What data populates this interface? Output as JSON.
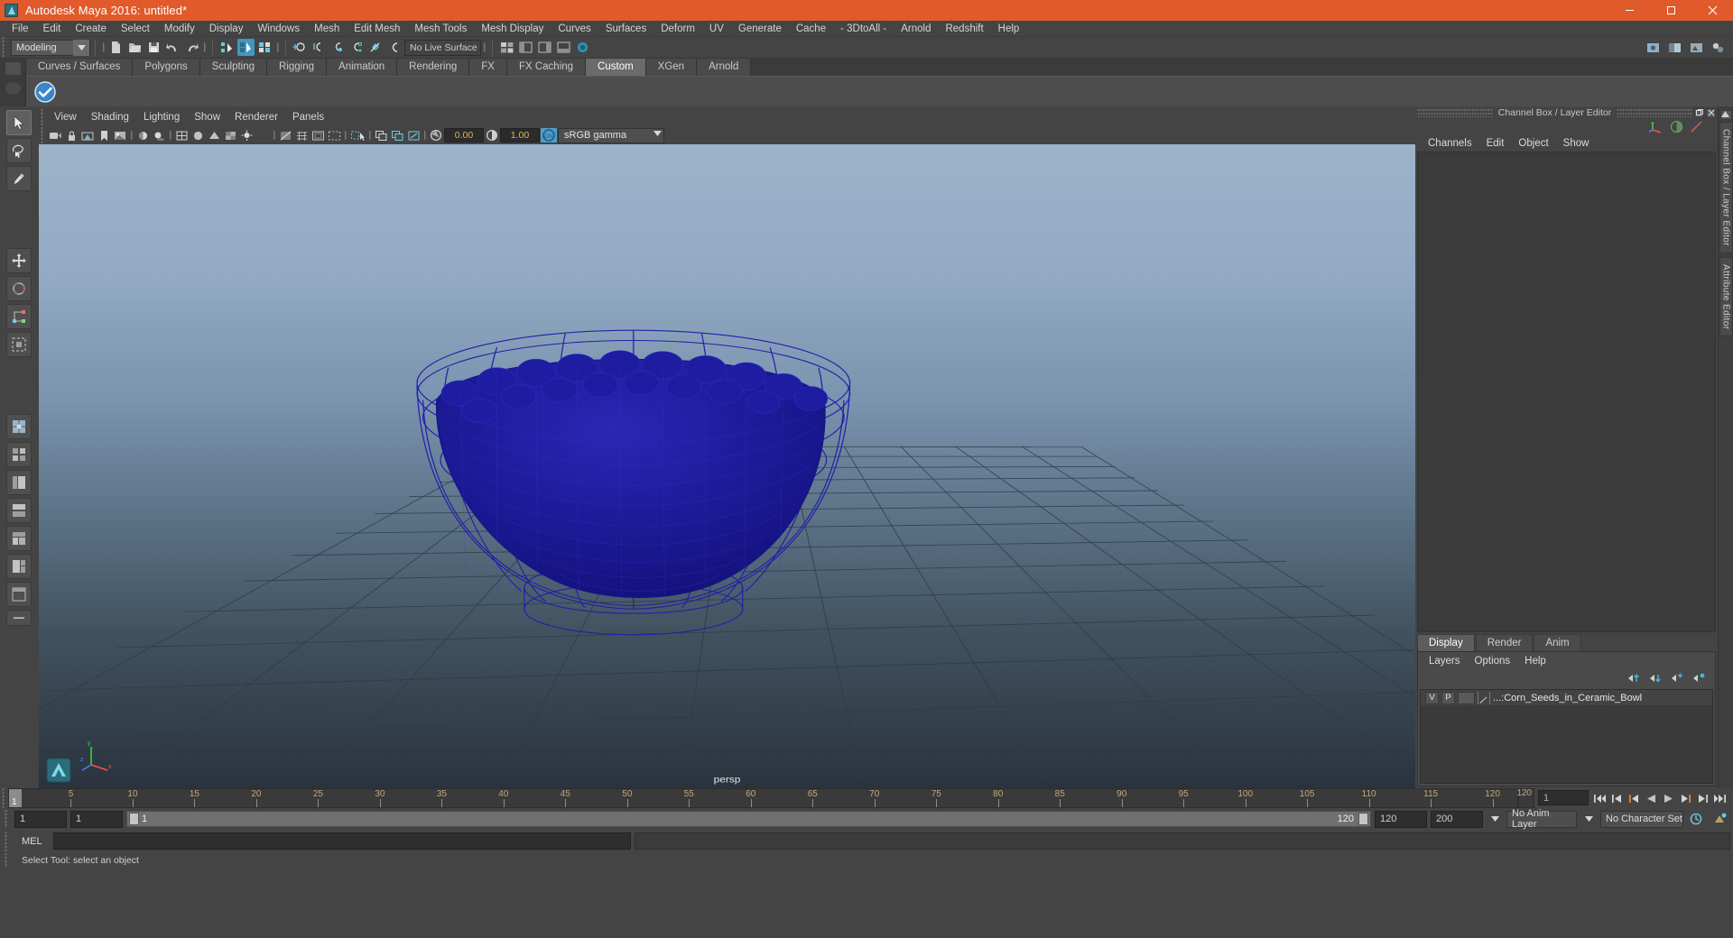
{
  "window": {
    "title": "Autodesk Maya 2016: untitled*",
    "logo_icon": "maya-logo-icon",
    "minimize_label": "Minimize",
    "maximize_label": "Maximize",
    "close_label": "Close",
    "accent_color": "#e05a2b"
  },
  "menubar": {
    "items": [
      "File",
      "Edit",
      "Create",
      "Select",
      "Modify",
      "Display",
      "Windows",
      "Mesh",
      "Edit Mesh",
      "Mesh Tools",
      "Mesh Display",
      "Curves",
      "Surfaces",
      "Deform",
      "UV",
      "Generate",
      "Cache",
      "- 3DtoAll -",
      "Arnold",
      "Redshift",
      "Help"
    ]
  },
  "statusbar": {
    "menu_set": "Modeling",
    "menu_set_arrow_icon": "chevron-down-icon",
    "icons": [
      "new-scene-icon",
      "open-scene-icon",
      "save-scene-icon",
      "undo-icon",
      "redo-icon",
      "select-hierarchy-icon",
      "select-object-icon",
      "select-component-icon",
      "snap-to-grid-icon",
      "snap-to-curve-icon",
      "snap-to-point-icon",
      "snap-to-projected-center-icon",
      "snap-to-view-plane-icon",
      "make-live-icon"
    ],
    "live_surface": "No Live Surface",
    "right_icons": [
      "show-hide-ui-icon",
      "render-view-icon",
      "ipr-render-icon",
      "render-settings-icon"
    ]
  },
  "shelf": {
    "tabs": [
      "Curves / Surfaces",
      "Polygons",
      "Sculpting",
      "Rigging",
      "Animation",
      "Rendering",
      "FX",
      "FX Caching",
      "Custom",
      "XGen",
      "Arnold"
    ],
    "active_tab": "Custom",
    "items": [
      {
        "icon": "3dtoall-badge-icon",
        "label": ""
      }
    ]
  },
  "toolbox": {
    "tools": [
      "select-tool",
      "lasso-select-tool",
      "paint-select-tool",
      "move-tool",
      "rotate-tool",
      "scale-tool",
      "soft-select-tool",
      "last-tool-used",
      "single-perspective-view-icon",
      "four-view-layout-icon",
      "persp-outliner-layout-icon",
      "persp-graph-layout-icon",
      "hypershade-persp-layout-icon",
      "persp-multi-layout-icon",
      "outliner-persp-layout-icon",
      "more-layouts-icon"
    ],
    "selected_tool": "select-tool"
  },
  "viewport": {
    "menus": [
      "View",
      "Shading",
      "Lighting",
      "Show",
      "Renderer",
      "Panels"
    ],
    "toolbar_icons": [
      "select-camera-icon",
      "lock-camera-icon",
      "camera-attributes-icon",
      "bookmark-icon",
      "image-plane-icon",
      "two-sided-lighting-icon",
      "shadows-icon",
      "wireframe-on-shaded-icon",
      "xray-icon",
      "xray-joints-icon",
      "smooth-shade-icon",
      "flat-shade-icon",
      "textured-icon",
      "use-all-lights-icon",
      "grid-toggle-icon",
      "film-gate-icon",
      "resolution-gate-icon",
      "gate-mask-icon",
      "isolate-select-icon",
      "exposure-icon",
      "gamma-icon",
      "color-management-toggle-icon"
    ],
    "exposure_value": "0.00",
    "gamma_value": "1.00",
    "color_management_state": "ON",
    "color_profile": "sRGB gamma",
    "camera_label": "persp",
    "axis_labels": {
      "x": "x",
      "y": "y",
      "z": "z"
    },
    "scene_object": "Corn Seeds in Ceramic Bowl wireframe",
    "wireframe_color": "#1b1a8e"
  },
  "channel_box": {
    "panel_title": "Channel Box / Layer Editor",
    "restore_icon": "restore-window-icon",
    "close_icon": "close-panel-icon",
    "header_icons": [
      "channel-box-icon",
      "attribute-editor-icon",
      "tool-settings-icon"
    ],
    "menus": [
      "Channels",
      "Edit",
      "Object",
      "Show"
    ]
  },
  "layer_editor": {
    "tabs": [
      "Display",
      "Render",
      "Anim"
    ],
    "active_tab": "Display",
    "menus": [
      "Layers",
      "Options",
      "Help"
    ],
    "buttons": [
      "move-layer-up-icon",
      "move-layer-down-icon",
      "new-layer-icon",
      "new-layer-from-selected-icon"
    ],
    "layers": [
      {
        "visibility": "V",
        "playback": "P",
        "name": "...:Corn_Seeds_in_Ceramic_Bowl"
      }
    ]
  },
  "vertical_tabs": [
    "Channel Box / Layer Editor",
    "Attribute Editor"
  ],
  "timeline": {
    "current_frame": "1",
    "ticks": [
      5,
      10,
      15,
      20,
      25,
      30,
      35,
      40,
      45,
      50,
      55,
      60,
      65,
      70,
      75,
      80,
      85,
      90,
      95,
      100,
      105,
      110,
      115,
      120
    ],
    "end_label": "120",
    "frame_field": "1",
    "playback_buttons": [
      "go-to-start-icon",
      "step-back-keyframe-icon",
      "step-back-frame-icon",
      "play-backwards-icon",
      "play-forwards-icon",
      "step-forward-frame-icon",
      "step-forward-keyframe-icon",
      "go-to-end-icon"
    ]
  },
  "range_slider": {
    "start_field": "1",
    "current_start_field": "1",
    "bar_start_label": "1",
    "bar_end_label": "120",
    "end_field": "120",
    "playback_end_field": "200",
    "anim_layer": "No Anim Layer",
    "character_set": "No Character Set",
    "anim_prefs_icon": "animation-preferences-icon",
    "anim_layer_arrow_icon": "chevron-down-icon"
  },
  "command_line": {
    "label": "MEL",
    "input_value": "",
    "output_value": ""
  },
  "status_line": {
    "message": "Select Tool: select an object"
  }
}
